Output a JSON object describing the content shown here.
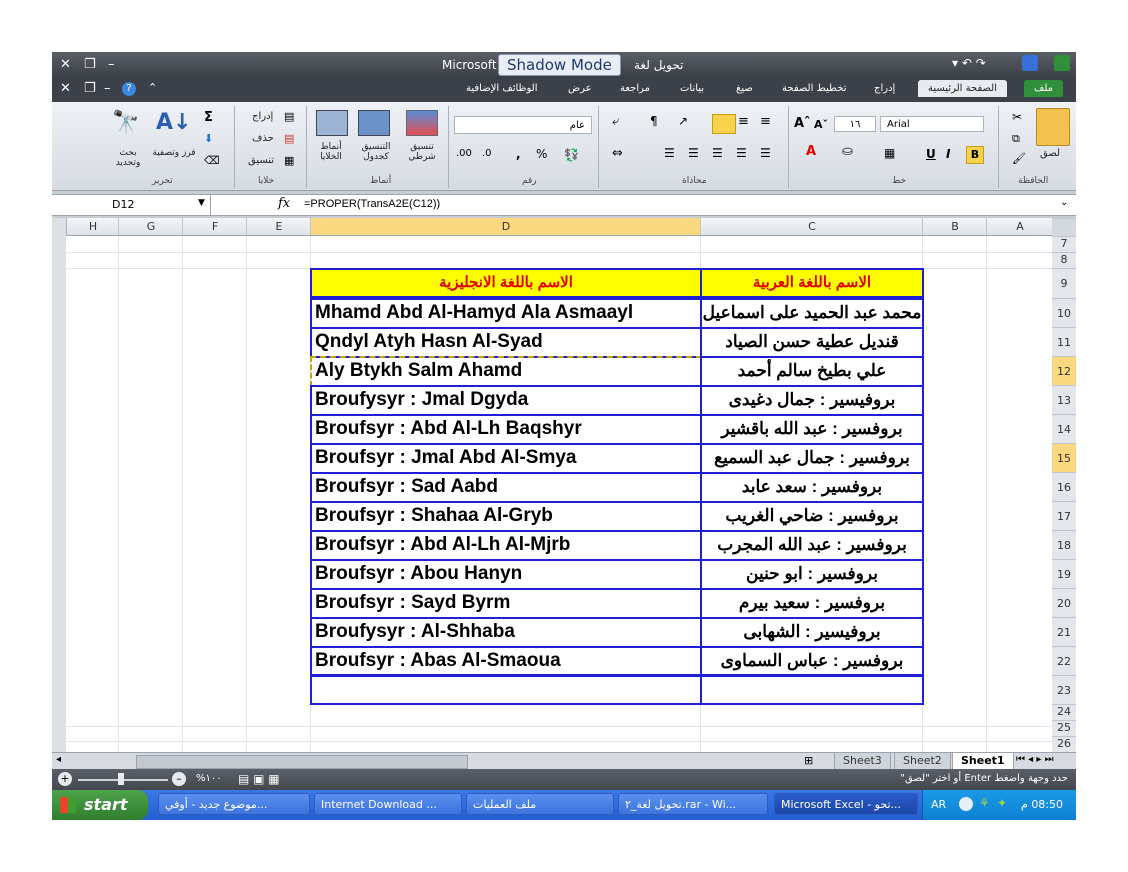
{
  "window": {
    "title": "تحويل لغة",
    "title_prefix": "Microsoft",
    "badge": "Shadow Mode"
  },
  "tabs": [
    {
      "label": "ملف"
    },
    {
      "label": "الصفحة الرئيسية"
    },
    {
      "label": "إدراج"
    },
    {
      "label": "تخطيط الصفحة"
    },
    {
      "label": "صيغ"
    },
    {
      "label": "بيانات"
    },
    {
      "label": "مراجعة"
    },
    {
      "label": "عرض"
    },
    {
      "label": "الوظائف الإضافية"
    }
  ],
  "ribbon": {
    "clipboard": {
      "paste": "لصق",
      "group": "الحافظة"
    },
    "font": {
      "name": "Arial",
      "size": "١٦",
      "bold": "B",
      "italic": "I",
      "underline": "U",
      "group": "خط"
    },
    "alignment": {
      "group": "محاذاة"
    },
    "number": {
      "format": "عام",
      "percent": "%",
      "comma": ",",
      "group": "رقم"
    },
    "styles": {
      "conditional": "تنسيق شرطي",
      "as_table": "التنسيق كجدول",
      "cell_styles": "أنماط الخلايا",
      "group": "أنماط"
    },
    "cells": {
      "insert": "إدراج",
      "delete": "حذف",
      "format": "تنسيق",
      "group": "خلايا"
    },
    "editing": {
      "sort": "فرز وتصفية",
      "find": "بحث وتحديد",
      "sigma": "Σ",
      "group": "تحرير"
    }
  },
  "formula_bar": {
    "name_box": "D12",
    "fx": "fx",
    "formula": "=PROPER(TransA2E(C12))"
  },
  "columns": [
    "A",
    "B",
    "C",
    "D",
    "E",
    "F",
    "G",
    "H"
  ],
  "rows": [
    "7",
    "8",
    "9",
    "10",
    "11",
    "12",
    "13",
    "14",
    "15",
    "16",
    "17",
    "18",
    "19",
    "20",
    "21",
    "22",
    "23",
    "24",
    "25",
    "26"
  ],
  "table": {
    "header_ar": "الاسم باللغة العربية",
    "header_en": "الاسم باللغة الانجليزية",
    "rows": [
      {
        "ar": "محمد عبد الحميد على اسماعيل",
        "en": "Mhamd Abd Al-Hamyd Ala Asmaayl"
      },
      {
        "ar": "قنديل عطية حسن الصياد",
        "en": "Qndyl Atyh Hasn Al-Syad"
      },
      {
        "ar": "علي بطيخ سالم أحمد",
        "en": "Aly Btykh Salm Ahamd"
      },
      {
        "ar": "بروفيسير : جمال دغيدى",
        "en": "Broufysyr  : Jmal Dgyda"
      },
      {
        "ar": "بروفسير : عبد الله باقشير",
        "en": "Broufsyr : Abd Al-Lh Baqshyr"
      },
      {
        "ar": "بروفسير : جمال عبد السميع",
        "en": "Broufsyr : Jmal Abd Al-Smya"
      },
      {
        "ar": "بروفسير : سعد عابد",
        "en": "Broufsyr : Sad Aabd"
      },
      {
        "ar": "بروفسير : ضاحي الغريب",
        "en": "Broufsyr : Shahaa Al-Gryb"
      },
      {
        "ar": "بروفسير : عبد الله المجرب",
        "en": "Broufsyr : Abd Al-Lh Al-Mjrb"
      },
      {
        "ar": "بروفسير : ابو حنين",
        "en": "Broufsyr : Abou Hanyn"
      },
      {
        "ar": "بروفسير : سعيد بيرم",
        "en": "Broufsyr : Sayd Byrm"
      },
      {
        "ar": "بروفيسير : الشهابى",
        "en": "Broufysyr : Al-Shhaba"
      },
      {
        "ar": "بروفسير : عباس السماوى",
        "en": "Broufsyr : Abas Al-Smaoua"
      }
    ]
  },
  "sheets": [
    {
      "label": "Sheet1"
    },
    {
      "label": "Sheet2"
    },
    {
      "label": "Sheet3"
    }
  ],
  "status": {
    "message": "حدد وجهة واضغط Enter أو اختر \"لصق\"",
    "zoom": "%١٠٠"
  },
  "taskbar": {
    "start": "start",
    "items": [
      {
        "label": "موضوع جديد - أوفي..."
      },
      {
        "label": "Internet Download ..."
      },
      {
        "label": "ملف العمليات"
      },
      {
        "label": "تحويل لغة_٢.rar - Wi..."
      },
      {
        "label": "Microsoft Excel - تحو..."
      }
    ],
    "lang": "AR",
    "clock": "08:50 م"
  },
  "colors": {
    "header_fill": "#ffff00",
    "header_text": "#e00000",
    "cell_border": "#1f1fd6",
    "selected_header": "#f9d87f"
  }
}
